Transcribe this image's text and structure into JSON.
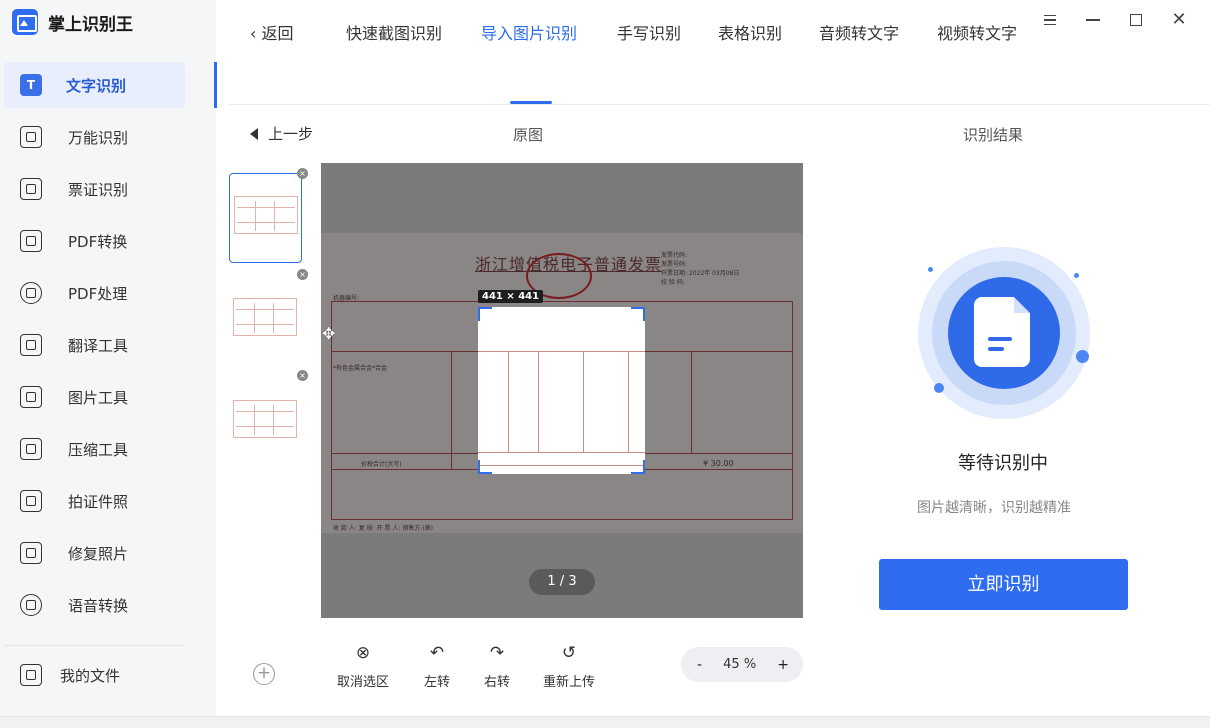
{
  "app": {
    "name": "掌上识别王"
  },
  "sidebar": {
    "active": {
      "icon": "T",
      "label": "文字识别"
    },
    "items": [
      {
        "label": "万能识别",
        "icon": "scan-search-icon"
      },
      {
        "label": "票证识别",
        "icon": "ticket-icon"
      },
      {
        "label": "PDF转换",
        "icon": "pdf-convert-icon"
      },
      {
        "label": "PDF处理",
        "icon": "pdf-process-icon"
      },
      {
        "label": "翻译工具",
        "icon": "translate-icon"
      },
      {
        "label": "图片工具",
        "icon": "image-icon"
      },
      {
        "label": "压缩工具",
        "icon": "compress-icon"
      },
      {
        "label": "拍证件照",
        "icon": "id-photo-icon"
      },
      {
        "label": "修复照片",
        "icon": "repair-photo-icon"
      },
      {
        "label": "语音转换",
        "icon": "voice-icon"
      }
    ],
    "my_files": "我的文件"
  },
  "tabs": {
    "back": "返回",
    "items": [
      "快速截图识别",
      "导入图片识别",
      "手写识别",
      "表格识别",
      "音频转文字",
      "视频转文字"
    ],
    "active_index": 1
  },
  "toolbar": {
    "prev_step": "上一步",
    "original_label": "原图",
    "result_label": "识别结果"
  },
  "preview": {
    "invoice_title": "浙江增值税电子普通发票",
    "selection_size": "441 × 441",
    "page_indicator": "1 / 3",
    "invoice_amount": "¥ 30.00"
  },
  "tools": {
    "cancel_selection": "取消选区",
    "rotate_left": "左转",
    "rotate_right": "右转",
    "reupload": "重新上传"
  },
  "zoom": {
    "minus": "-",
    "value": "45 %",
    "plus": "+"
  },
  "result": {
    "status": "等待识别中",
    "hint": "图片越清晰，识别越精准",
    "button": "立即识别"
  },
  "colors": {
    "accent": "#2e6cf0",
    "sidebar_bg": "#f5f6f8"
  }
}
